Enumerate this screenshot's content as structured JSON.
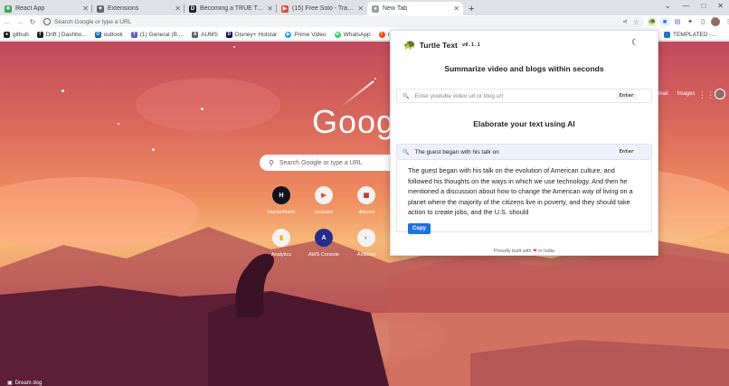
{
  "tabs": [
    {
      "title": "React App",
      "favicon": "react-icon",
      "color": "#34a853"
    },
    {
      "title": "Extensions",
      "favicon": "puzzle-icon",
      "color": "#5f6368"
    },
    {
      "title": "Becoming a TRUE Tech Le",
      "favicon": "dev-icon",
      "color": "#202124"
    },
    {
      "title": "(15) Free Solo - Trailer | Na",
      "favicon": "youtube-icon",
      "color": "#ea4335"
    },
    {
      "title": "New Tab",
      "favicon": "chrome-icon",
      "color": "#5f6368"
    }
  ],
  "omnibox": {
    "placeholder": "Search Google or type a URL"
  },
  "bookmarks": [
    {
      "label": "github",
      "icon": "github-icon",
      "color": "#202124"
    },
    {
      "label": "Drift | Dashbo...",
      "icon": "drift-icon",
      "color": "#202124"
    },
    {
      "label": "outlook",
      "icon": "outlook-icon",
      "color": "#0a64d6"
    },
    {
      "label": "(1) General (B....",
      "icon": "teams-icon",
      "color": "#5b5fc7"
    },
    {
      "label": "AUMS",
      "icon": "aums-icon",
      "color": "#5f6368"
    },
    {
      "label": "Disney+ Hotstar",
      "icon": "hotstar-icon",
      "color": "#0c1447"
    },
    {
      "label": "Prime Video",
      "icon": "prime-icon",
      "color": "#1a98ff"
    },
    {
      "label": "WhatsApp",
      "icon": "whatsapp-icon",
      "color": "#25d366"
    },
    {
      "label": "reddi",
      "icon": "reddit-icon",
      "color": "#ff4500"
    }
  ],
  "bookmarks_right": {
    "label": "TEMPLATED -..."
  },
  "newtab": {
    "logo": "Google",
    "search_placeholder": "Search Google or type a URL",
    "gmail": "Gmail",
    "images": "Images",
    "shortcuts": [
      {
        "label": "HackerRank",
        "glyph": "H",
        "color": "#1ba94c"
      },
      {
        "label": "youtube",
        "glyph": "▶",
        "color": "#ea4335"
      },
      {
        "label": "discord",
        "glyph": "D",
        "color": "#5865f2"
      },
      {
        "label": "Analytics",
        "glyph": "▮",
        "color": "#f9ab00"
      },
      {
        "label": "AWS Console",
        "glyph": "A",
        "color": "#232f3e"
      },
      {
        "label": "Ambient",
        "glyph": "◐",
        "color": "#80868b"
      }
    ],
    "credit": "Dream dog"
  },
  "popup": {
    "title": "Turtle Text",
    "version": "v0.1.1",
    "summarize_heading": "Summarize video and blogs within seconds",
    "url_placeholder": "Enter youtube video url or blog url",
    "enter_label": "Enter",
    "elaborate_heading": "Elaborate your text using AI",
    "elaborate_input": "The guest began with his talk on",
    "elaborate_enter_label": "Enter",
    "result": "The guest began with his talk on the evolution of American culture, and followed his thoughts on the ways in which we use technology. And then he mentioned a discussion about how to change the American way of living on a planet where the majority of the citizens live in poverty, and they should take action to create jobs, and the U.S. should",
    "copy_label": "Copy",
    "footer_pre": "Proudly built with",
    "footer_post": "in India"
  }
}
